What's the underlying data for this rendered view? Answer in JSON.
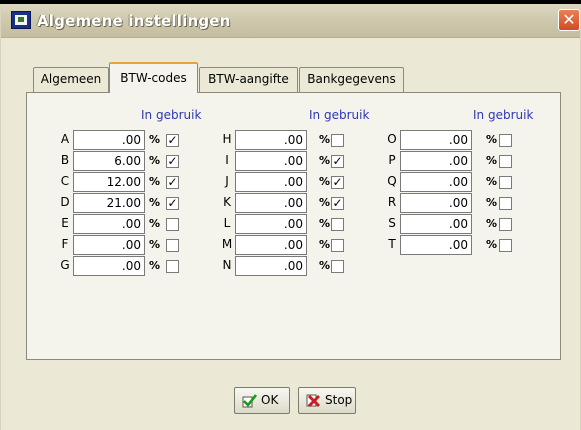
{
  "window": {
    "title": "Algemene instellingen",
    "close_symbol": "✕"
  },
  "tabs": [
    {
      "label": "Algemeen",
      "active": false
    },
    {
      "label": "BTW-codes",
      "active": true
    },
    {
      "label": "BTW-aangifte",
      "active": false
    },
    {
      "label": "Bankgegevens",
      "active": false
    }
  ],
  "columns": {
    "header": "In gebruik",
    "percent_symbol": "%",
    "rows": [
      {
        "letter": "A",
        "value": ".00",
        "checked": true
      },
      {
        "letter": "B",
        "value": "6.00",
        "checked": true
      },
      {
        "letter": "C",
        "value": "12.00",
        "checked": true
      },
      {
        "letter": "D",
        "value": "21.00",
        "checked": true
      },
      {
        "letter": "E",
        "value": ".00",
        "checked": false
      },
      {
        "letter": "F",
        "value": ".00",
        "checked": false
      },
      {
        "letter": "G",
        "value": ".00",
        "checked": false
      },
      {
        "letter": "H",
        "value": ".00",
        "checked": false
      },
      {
        "letter": "I",
        "value": ".00",
        "checked": true
      },
      {
        "letter": "J",
        "value": ".00",
        "checked": true
      },
      {
        "letter": "K",
        "value": ".00",
        "checked": true
      },
      {
        "letter": "L",
        "value": ".00",
        "checked": false
      },
      {
        "letter": "M",
        "value": ".00",
        "checked": false
      },
      {
        "letter": "N",
        "value": ".00",
        "checked": false
      },
      {
        "letter": "O",
        "value": ".00",
        "checked": false
      },
      {
        "letter": "P",
        "value": ".00",
        "checked": false
      },
      {
        "letter": "Q",
        "value": ".00",
        "checked": false
      },
      {
        "letter": "R",
        "value": ".00",
        "checked": false
      },
      {
        "letter": "S",
        "value": ".00",
        "checked": false
      },
      {
        "letter": "T",
        "value": ".00",
        "checked": false
      }
    ]
  },
  "buttons": {
    "ok_label": "OK",
    "stop_label": "Stop"
  },
  "icons": {
    "app": "app-icon",
    "close": "close-icon",
    "ok": "checkmark-icon",
    "stop": "cross-icon"
  },
  "colors": {
    "column_header": "#2f37b2",
    "active_tab_accent": "#e4a53c",
    "close_button": "#d34a22"
  }
}
